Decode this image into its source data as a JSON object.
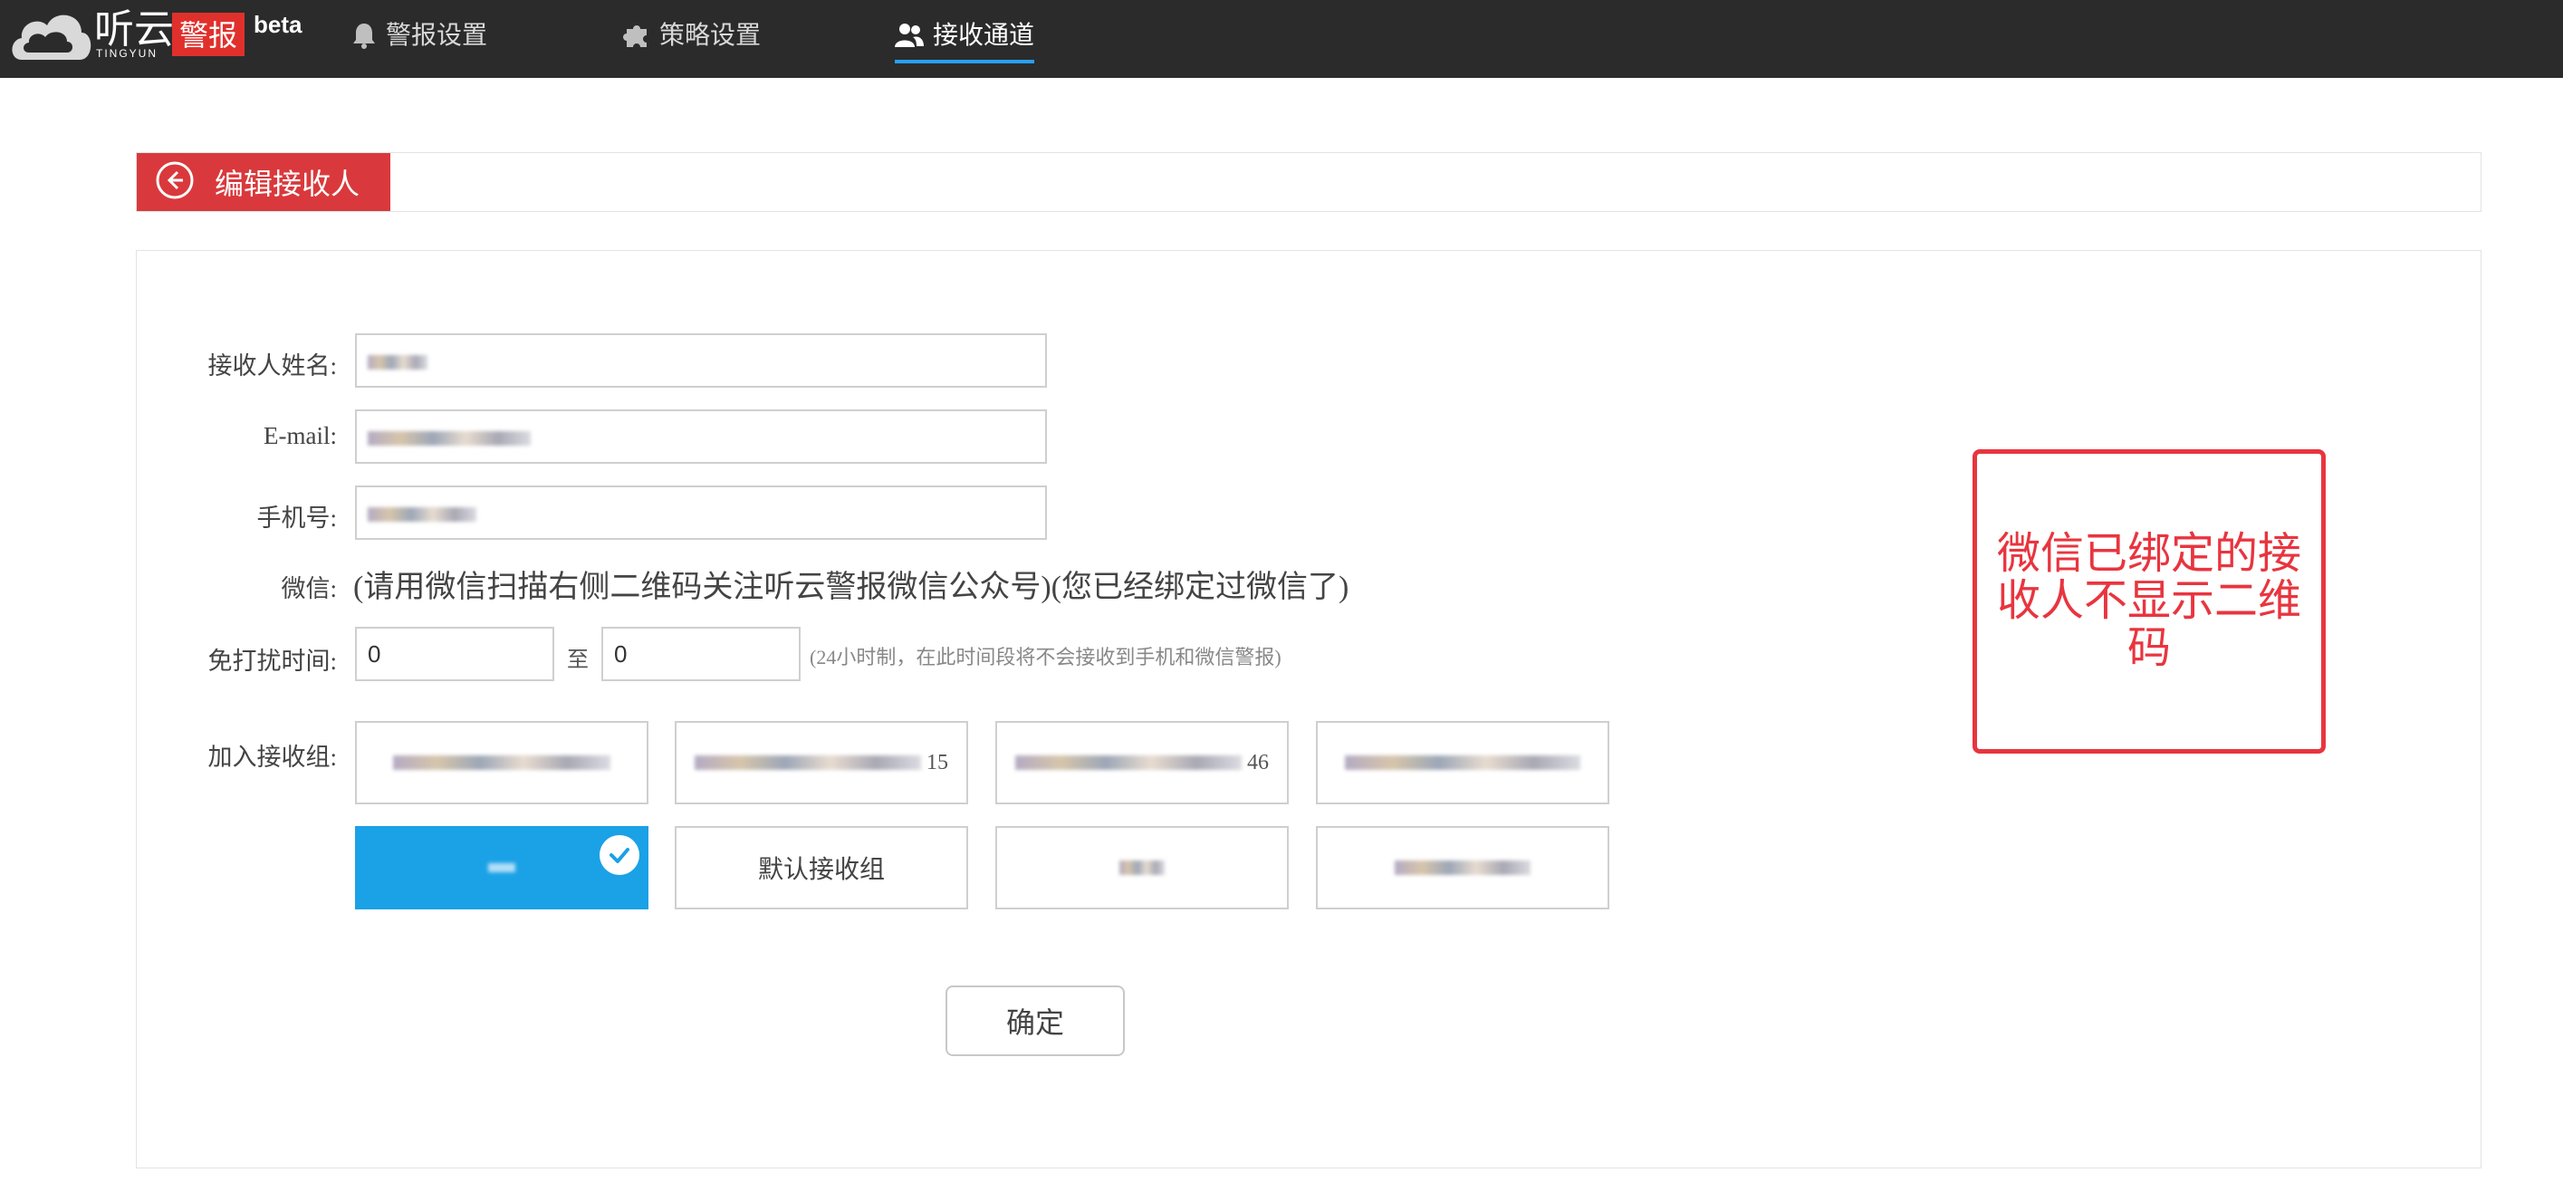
{
  "brand": {
    "name": "听云",
    "sub": "TINGYUN",
    "badge": "警报",
    "beta": "beta"
  },
  "nav": {
    "items": [
      {
        "label": "警报设置",
        "icon": "bell-icon"
      },
      {
        "label": "策略设置",
        "icon": "puzzle-icon"
      },
      {
        "label": "接收通道",
        "icon": "users-icon",
        "active": true
      }
    ]
  },
  "page": {
    "title": "编辑接收人"
  },
  "form": {
    "name_label": "接收人姓名:",
    "email_label": "E-mail:",
    "phone_label": "手机号:",
    "wechat_label": "微信:",
    "wechat_note": "(请用微信扫描右侧二维码关注听云警报微信公众号)(您已经绑定过微信了)",
    "dnd_label": "免打扰时间:",
    "dnd_from": "0",
    "dnd_to_label": "至",
    "dnd_to": "0",
    "dnd_hint": "(24小时制，在此时间段将不会接收到手机和微信警报)",
    "groups_label": "加入接收组:"
  },
  "groups": [
    {
      "label": "",
      "suffix": ""
    },
    {
      "label": "",
      "suffix": "15"
    },
    {
      "label": "",
      "suffix": "46"
    },
    {
      "label": "",
      "suffix": ""
    },
    {
      "label": "",
      "selected": true
    },
    {
      "label": "默认接收组"
    },
    {
      "label": ""
    },
    {
      "label": ""
    }
  ],
  "actions": {
    "confirm": "确定"
  },
  "annotation": {
    "text": "微信已绑定的接收人不显示二维码"
  },
  "colors": {
    "topbar": "#2b2b2b",
    "brand_red": "#e0302c",
    "title_red": "#d9393c",
    "selected_blue": "#1ba1e6",
    "annotation_red": "#e8353f",
    "nav_underline": "#2a9ff0"
  }
}
